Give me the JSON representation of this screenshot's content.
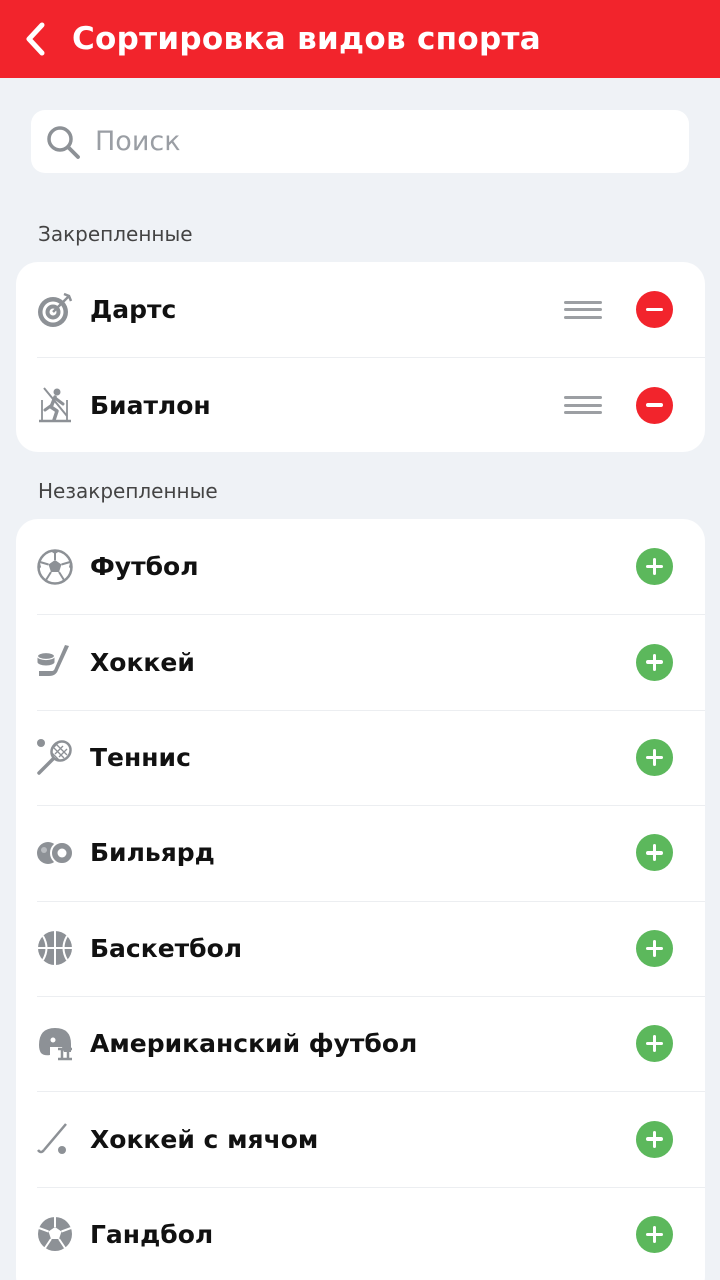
{
  "header": {
    "title": "Сортировка видов спорта"
  },
  "search": {
    "placeholder": "Поиск"
  },
  "pinned": {
    "label": "Закрепленные",
    "items": [
      {
        "name": "Дартс",
        "icon": "darts-icon"
      },
      {
        "name": "Биатлон",
        "icon": "biathlon-icon"
      }
    ]
  },
  "unpinned": {
    "label": "Незакрепленные",
    "items": [
      {
        "name": "Футбол",
        "icon": "soccer-ball-icon"
      },
      {
        "name": "Хоккей",
        "icon": "hockey-icon"
      },
      {
        "name": "Теннис",
        "icon": "tennis-icon"
      },
      {
        "name": "Бильярд",
        "icon": "billiards-icon"
      },
      {
        "name": "Баскетбол",
        "icon": "basketball-icon"
      },
      {
        "name": "Американский футбол",
        "icon": "football-helmet-icon"
      },
      {
        "name": "Хоккей с мячом",
        "icon": "bandy-icon"
      },
      {
        "name": "Гандбол",
        "icon": "handball-icon"
      }
    ]
  },
  "colors": {
    "header": "#f2242c",
    "remove": "#f2242c",
    "add": "#5cb85c",
    "icon": "#8d9196"
  }
}
